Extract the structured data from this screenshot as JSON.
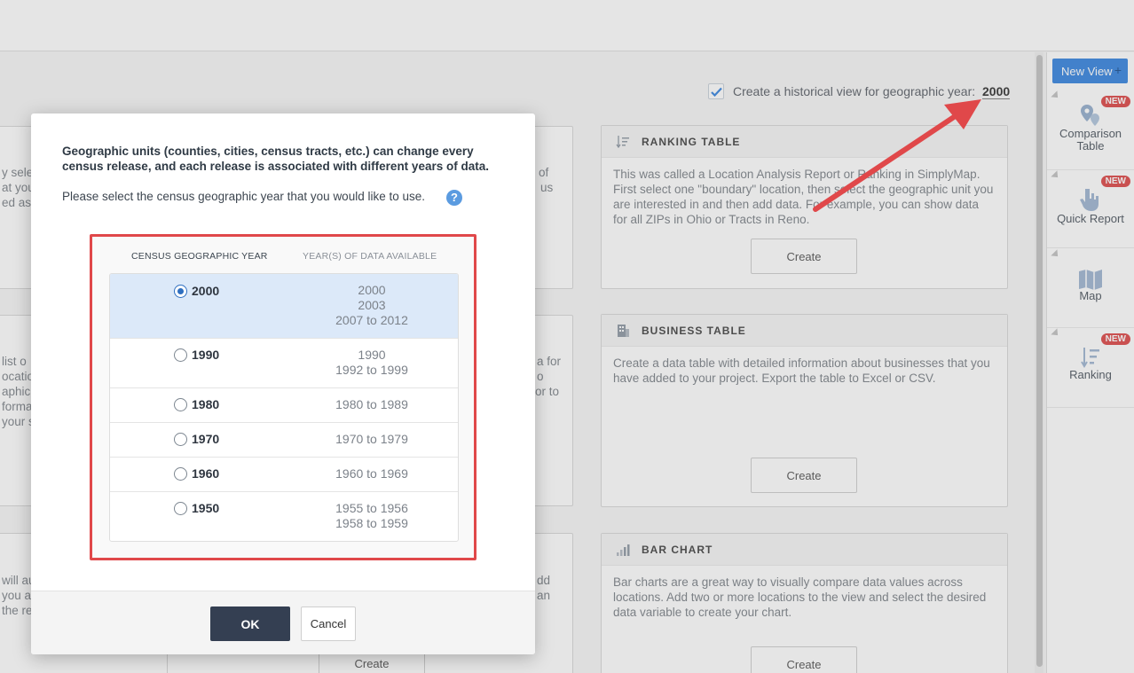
{
  "header": {
    "new_view_label": "New View",
    "new_view_plus": "+"
  },
  "historical": {
    "checked": true,
    "label": "Create a historical view for geographic year:",
    "year": "2000"
  },
  "sidebar": {
    "items": [
      {
        "label_line1": "Comparison",
        "label_line2": "Table",
        "badge": "NEW",
        "icon": "map-pin-icon"
      },
      {
        "label_line1": "Quick Report",
        "label_line2": "",
        "badge": "NEW",
        "icon": "hand-pointer-icon"
      },
      {
        "label_line1": "Map",
        "label_line2": "",
        "badge": "",
        "icon": "map-icon"
      },
      {
        "label_line1": "Ranking",
        "label_line2": "",
        "badge": "NEW",
        "icon": "ranking-icon"
      }
    ]
  },
  "cards": [
    {
      "title": "RANKING TABLE",
      "description": "This was called a Location Analysis Report or Ranking in SimplyMap. First select one \"boundary\" location, then select the geographic unit you are interested in and then add data. For example, you can show data for all ZIPs in Ohio or Tracts in Reno.",
      "button": "Create"
    },
    {
      "title": "BUSINESS TABLE",
      "description": "Create a data table with detailed information about businesses that you have added to your project. Export the table to Excel or CSV.",
      "button": "Create"
    },
    {
      "title": "BAR CHART",
      "description": "Bar charts are a great way to visually compare data values across locations. Add two or more locations to the view and select the desired data variable to create your chart.",
      "button": "Create"
    }
  ],
  "background_fragments": {
    "left_col": [
      "y sele",
      "at you",
      "ed as h",
      "list o",
      "ocation",
      "aphic",
      "forma",
      "your s",
      "will au",
      "you a",
      "the re"
    ],
    "mid_col": [
      "of",
      "us",
      "a for",
      "o",
      "or to",
      "dd",
      "an"
    ],
    "hidden_create": "Create"
  },
  "modal": {
    "intro": "Geographic units (counties, cities, census tracts, etc.) can change every census release, and each release is associated with different years of data.",
    "prompt": "Please select the census geographic year that you would like to use.",
    "help": "?",
    "col_year": "CENSUS GEOGRAPHIC YEAR",
    "col_data": "YEAR(S) OF DATA AVAILABLE",
    "rows": [
      {
        "year": "2000",
        "selected": true,
        "data": [
          "2000",
          "2003",
          "2007 to 2012"
        ]
      },
      {
        "year": "1990",
        "selected": false,
        "data": [
          "1990",
          "1992 to 1999"
        ]
      },
      {
        "year": "1980",
        "selected": false,
        "data": [
          "1980 to 1989"
        ]
      },
      {
        "year": "1970",
        "selected": false,
        "data": [
          "1970 to 1979"
        ]
      },
      {
        "year": "1960",
        "selected": false,
        "data": [
          "1960 to 1969"
        ]
      },
      {
        "year": "1950",
        "selected": false,
        "data": [
          "1955 to 1956",
          "1958 to 1959"
        ]
      }
    ],
    "ok": "OK",
    "cancel": "Cancel"
  },
  "colors": {
    "accent": "#4a90e2",
    "ok_button": "#343f52",
    "annotation_red": "#e0484a",
    "badge_red": "#e05a5a",
    "selected_row": "#dce9f9"
  }
}
